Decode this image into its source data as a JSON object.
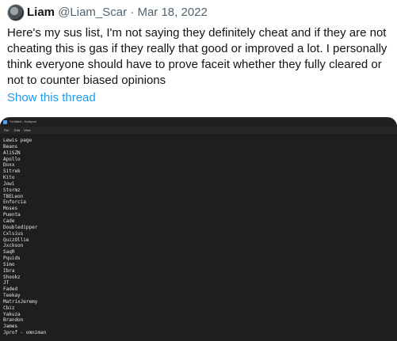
{
  "tweet": {
    "display_name": "Liam",
    "handle": "@Liam_Scar",
    "separator": "·",
    "date": "Mar 18, 2022",
    "text": "Here's my sus list,  I'm not saying they definitely cheat and if they are not cheating this is gas if they really that good or improved a lot. I personally think everyone should have to prove faceit whether they fully cleared or not to counter biased opinions",
    "show_thread_label": "Show this thread",
    "link_color": "#1d9bf0"
  },
  "notepad": {
    "window_title": "*Untitled - Notepad",
    "menu": [
      "File",
      "Edit",
      "View"
    ],
    "lines": [
      "Lewis page",
      "Beans",
      "AliSZN",
      "Apollo",
      "Doxx",
      "Sitrek",
      "Kito",
      "Jowi",
      "Stormz",
      "TBELeon",
      "Enforcia",
      "Moses",
      "Puenta",
      "Cade",
      "Doubledipper",
      "Cxlsius",
      "QuizOllie",
      "Jxckson",
      "SaqR",
      "Pquids",
      "Simo",
      "Ibra",
      "Shookz",
      "JT",
      "Faded",
      "Teekay",
      "MatrixJeremy",
      "Cbiz",
      "Yakuza",
      "Brandon",
      "James",
      "Jprof - omniman"
    ]
  }
}
